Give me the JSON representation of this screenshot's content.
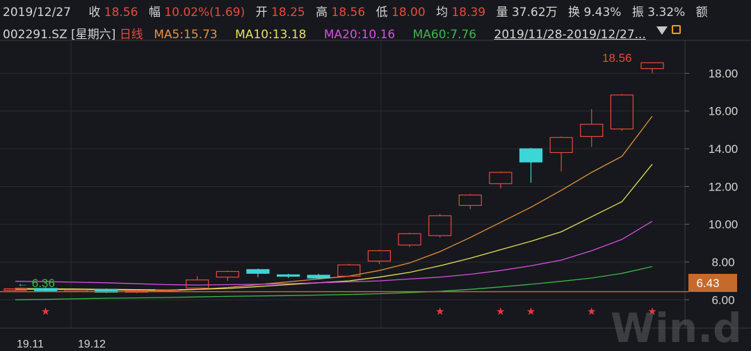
{
  "header": {
    "date": "2019/12/27",
    "close_label": "收",
    "close_value": "18.56",
    "change_label": "幅",
    "change_value": "10.02%(1.69)",
    "open_label": "开",
    "open_value": "18.25",
    "high_label": "高",
    "high_value": "18.56",
    "low_label": "低",
    "low_value": "18.00",
    "avg_label": "均",
    "avg_value": "18.39",
    "volume_label": "量",
    "volume_value": "37.62万",
    "turnover_label": "换",
    "turnover_value": "9.43%",
    "amplitude_label": "振",
    "amplitude_value": "3.32%",
    "amount_label": "额"
  },
  "subheader": {
    "code": "002291.SZ [星期六]",
    "period": "日线",
    "ma5": "MA5:15.73",
    "ma10": "MA10:13.18",
    "ma20": "MA20:10.16",
    "ma60": "MA60:7.76",
    "range": "2019/11/28-2019/12/27..."
  },
  "watermark": "Win.d",
  "colors": {
    "up": "#e84a3c",
    "down": "#3cd6d6",
    "ma5": "#e8923c",
    "ma10": "#e6e05a",
    "ma20": "#d650e0",
    "ma60": "#3cb84a",
    "bg": "#16181d",
    "marker": "#c46a2c"
  },
  "chart_data": {
    "type": "candlestick",
    "y_axis": {
      "ticks": [
        "6.00",
        "8.00",
        "10.00",
        "12.00",
        "14.00",
        "16.00",
        "18.00"
      ],
      "min": 4.5,
      "max": 19.6
    },
    "x_labels": [
      "19.11",
      "19.12"
    ],
    "candles": [
      {
        "open": 6.5,
        "close": 6.58,
        "high": 6.62,
        "low": 6.45
      },
      {
        "open": 6.6,
        "close": 6.48,
        "high": 6.65,
        "low": 6.42
      },
      {
        "open": 6.48,
        "close": 6.52,
        "high": 6.56,
        "low": 6.44
      },
      {
        "open": 6.55,
        "close": 6.4,
        "high": 6.6,
        "low": 6.35
      },
      {
        "open": 6.4,
        "close": 6.48,
        "high": 6.52,
        "low": 6.36
      },
      {
        "open": 6.5,
        "close": 6.52,
        "high": 6.55,
        "low": 6.45
      },
      {
        "open": 6.62,
        "close": 7.05,
        "high": 7.25,
        "low": 6.6
      },
      {
        "open": 7.2,
        "close": 7.5,
        "high": 7.55,
        "low": 7.0
      },
      {
        "open": 7.6,
        "close": 7.4,
        "high": 7.65,
        "low": 7.2
      },
      {
        "open": 7.32,
        "close": 7.28,
        "high": 7.38,
        "low": 7.15
      },
      {
        "open": 7.3,
        "close": 7.15,
        "high": 7.38,
        "low": 7.1
      },
      {
        "open": 7.25,
        "close": 7.85,
        "high": 7.9,
        "low": 7.2
      },
      {
        "open": 8.05,
        "close": 8.6,
        "high": 8.65,
        "low": 7.9
      },
      {
        "open": 8.9,
        "close": 9.5,
        "high": 9.55,
        "low": 8.8
      },
      {
        "open": 9.4,
        "close": 10.45,
        "high": 10.55,
        "low": 9.3
      },
      {
        "open": 11.0,
        "close": 11.55,
        "high": 11.6,
        "low": 10.8
      },
      {
        "open": 12.15,
        "close": 12.75,
        "high": 12.8,
        "low": 11.9
      },
      {
        "open": 14.0,
        "close": 13.3,
        "high": 14.05,
        "low": 12.2
      },
      {
        "open": 13.8,
        "close": 14.6,
        "high": 14.65,
        "low": 12.8
      },
      {
        "open": 14.65,
        "close": 15.3,
        "high": 16.1,
        "low": 14.1
      },
      {
        "open": 15.05,
        "close": 16.85,
        "high": 16.9,
        "low": 14.95
      },
      {
        "open": 18.25,
        "close": 18.56,
        "high": 18.56,
        "low": 18.0
      }
    ],
    "series": [
      {
        "name": "MA5",
        "values": [
          6.55,
          6.55,
          6.53,
          6.52,
          6.5,
          6.48,
          6.55,
          6.65,
          6.8,
          6.95,
          7.1,
          7.25,
          7.55,
          7.95,
          8.55,
          9.3,
          10.1,
          10.9,
          11.8,
          12.75,
          13.6,
          15.73
        ]
      },
      {
        "name": "MA10",
        "values": [
          6.6,
          6.58,
          6.57,
          6.55,
          6.54,
          6.52,
          6.55,
          6.6,
          6.7,
          6.8,
          6.9,
          7.0,
          7.2,
          7.45,
          7.8,
          8.2,
          8.65,
          9.1,
          9.6,
          10.4,
          11.2,
          13.18
        ]
      },
      {
        "name": "MA20",
        "values": [
          6.98,
          6.96,
          6.93,
          6.9,
          6.85,
          6.8,
          6.78,
          6.8,
          6.82,
          6.85,
          6.9,
          6.95,
          7.0,
          7.1,
          7.2,
          7.35,
          7.55,
          7.8,
          8.1,
          8.6,
          9.2,
          10.16
        ]
      },
      {
        "name": "MA60",
        "values": [
          6.0,
          6.02,
          6.05,
          6.08,
          6.1,
          6.12,
          6.15,
          6.18,
          6.2,
          6.22,
          6.25,
          6.28,
          6.32,
          6.38,
          6.45,
          6.55,
          6.68,
          6.82,
          6.98,
          7.15,
          7.4,
          7.76
        ]
      }
    ],
    "reference_line": {
      "value": 6.43,
      "label": "6.43"
    },
    "min_label": "6.36",
    "max_label": "18.56",
    "star_marker": "★",
    "star_candles": [
      1,
      14,
      16,
      17,
      19,
      21
    ]
  }
}
